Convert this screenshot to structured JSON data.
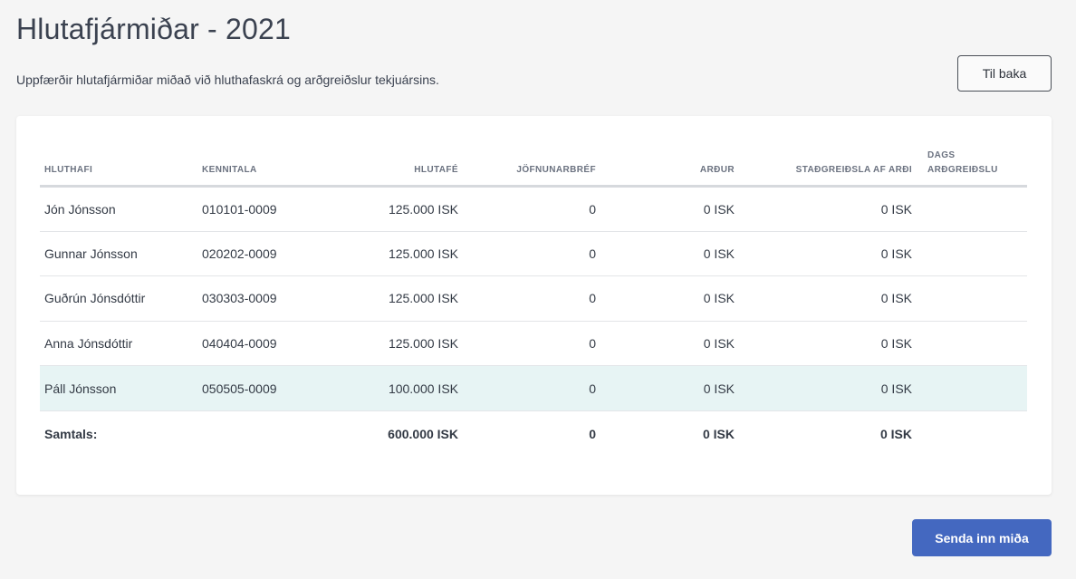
{
  "header": {
    "title": "Hlutafjármiðar - 2021",
    "subtitle": "Uppfærðir hlutafjármiðar miðað við hluthafaskrá og arðgreiðslur tekjuársins.",
    "back_label": "Til baka"
  },
  "table": {
    "columns": [
      "HLUTHAFI",
      "KENNITALA",
      "HLUTAFÉ",
      "JÖFNUNARBRÉF",
      "ARÐUR",
      "STAÐGREIÐSLA AF ARÐI",
      "DAGS ARÐGREIÐSLU"
    ],
    "rows": [
      [
        "Jón Jónsson",
        "010101-0009",
        "125.000 ISK",
        "0",
        "0 ISK",
        "0 ISK",
        ""
      ],
      [
        "Gunnar Jónsson",
        "020202-0009",
        "125.000 ISK",
        "0",
        "0 ISK",
        "0 ISK",
        ""
      ],
      [
        "Guðrún Jónsdóttir",
        "030303-0009",
        "125.000 ISK",
        "0",
        "0 ISK",
        "0 ISK",
        ""
      ],
      [
        "Anna Jónsdóttir",
        "040404-0009",
        "125.000 ISK",
        "0",
        "0 ISK",
        "0 ISK",
        ""
      ],
      [
        "Páll Jónsson",
        "050505-0009",
        "100.000 ISK",
        "0",
        "0 ISK",
        "0 ISK",
        ""
      ]
    ],
    "highlighted_row": 4,
    "total": {
      "label": "Samtals:",
      "hlutafe": "600.000 ISK",
      "jofnunarbref": "0",
      "ardur": "0 ISK",
      "stadgreidsla": "0 ISK"
    }
  },
  "footer": {
    "submit_label": "Senda inn miða"
  }
}
